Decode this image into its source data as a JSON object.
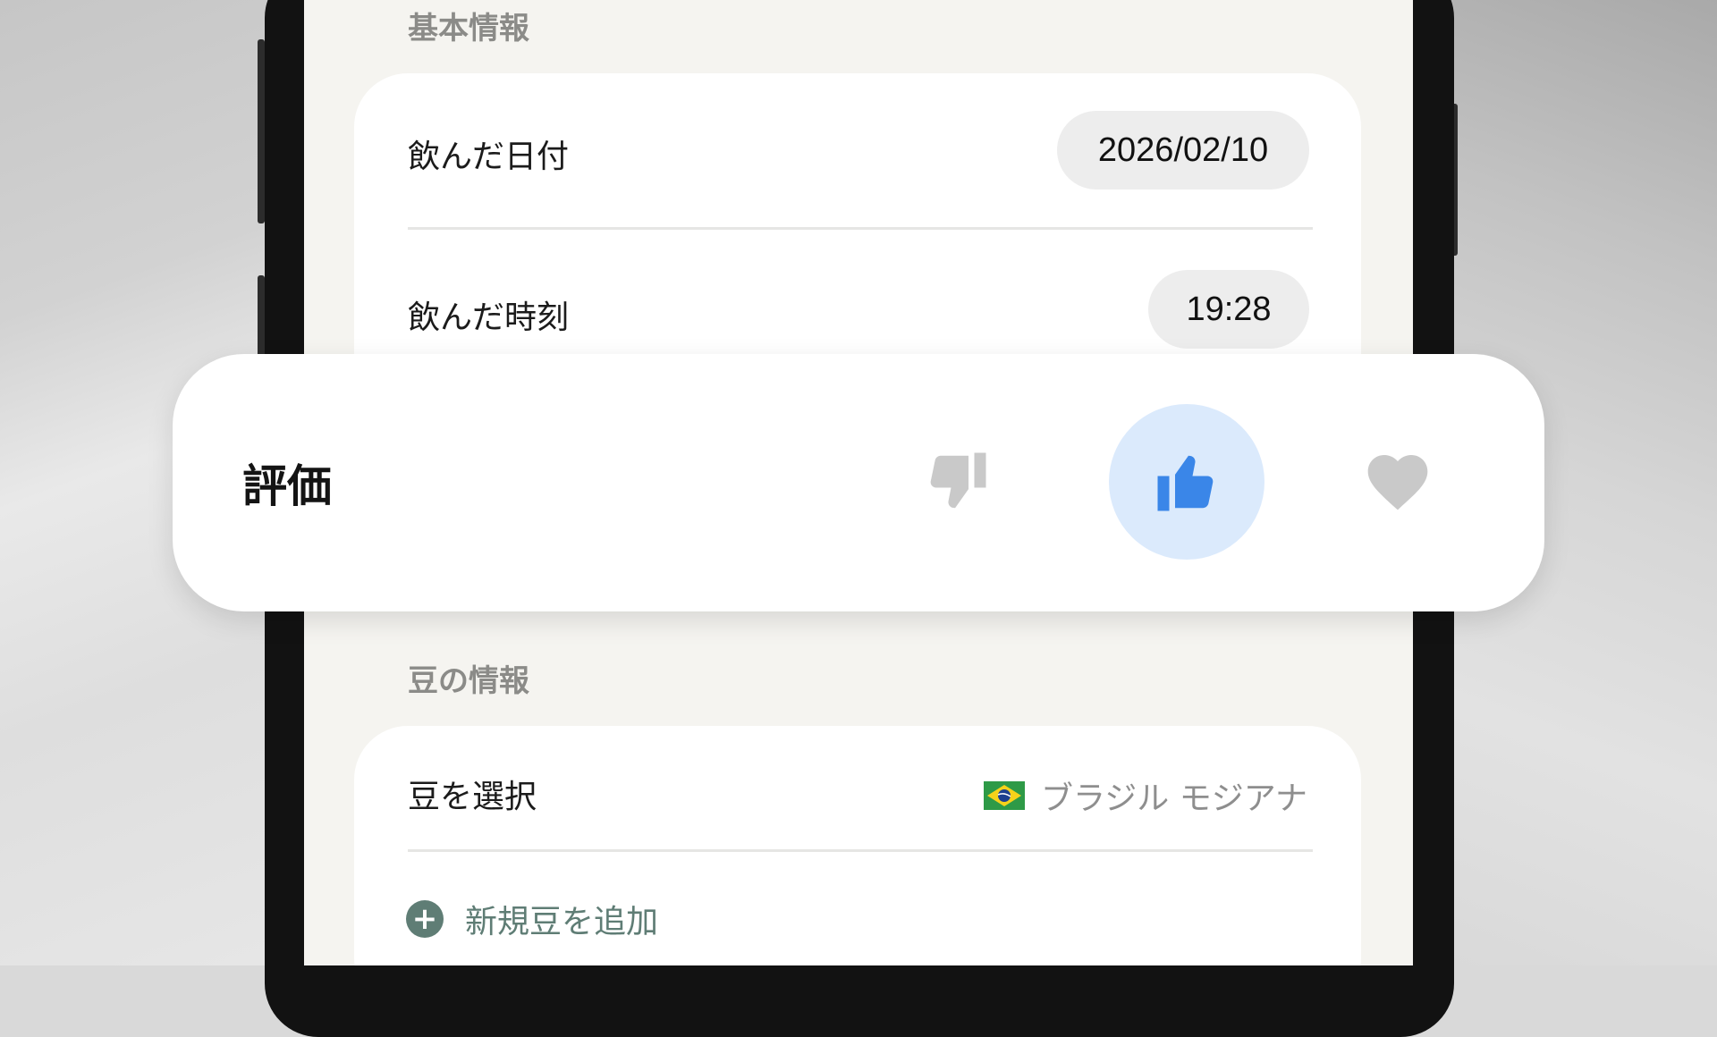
{
  "sections": {
    "basic_header": "基本情報",
    "bean_header": "豆の情報"
  },
  "basic": {
    "date_label": "飲んだ日付",
    "date_value": "2026/02/10",
    "time_label": "飲んだ時刻",
    "time_value": "19:28"
  },
  "rating": {
    "label": "評価",
    "options": [
      "thumbs-down",
      "thumbs-up",
      "heart"
    ],
    "selected": "thumbs-up"
  },
  "bean": {
    "select_label": "豆を選択",
    "selected_bean": "ブラジル モジアナ",
    "flag": "brazil-flag",
    "add_label": "新規豆を追加"
  },
  "colors": {
    "selected_accent": "#3a86e8",
    "selected_bg": "#dbeafc",
    "add_accent": "#5f7d75",
    "inactive_icon": "#c9c9c9"
  }
}
